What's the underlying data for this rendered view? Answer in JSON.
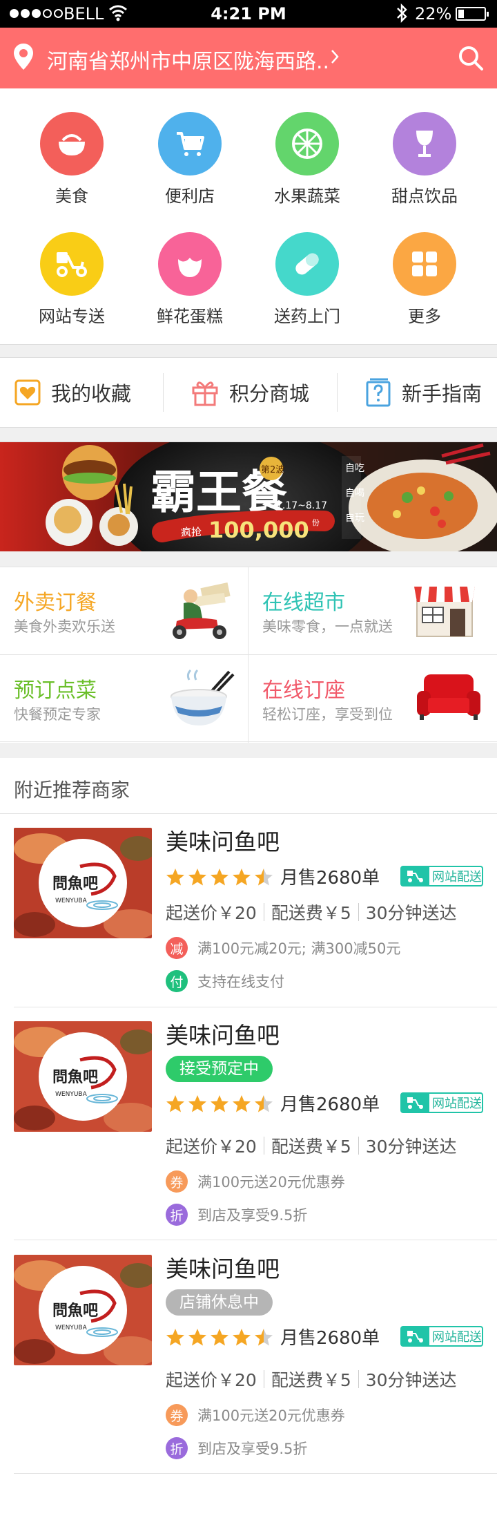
{
  "status_bar": {
    "carrier": "BELL",
    "time": "4:21 PM",
    "battery": "22%",
    "battery_level": 0.22,
    "signal_bars_filled": 3,
    "signal_bars_total": 5
  },
  "header": {
    "address": "河南省郑州市中原区陇海西路..",
    "icons": [
      "location-pin-icon",
      "chevron-right-icon",
      "search-icon"
    ],
    "bg_color": "#ff6e6e"
  },
  "categories": [
    {
      "label": "美食",
      "icon": "bowl-icon",
      "color": "#f35f5a"
    },
    {
      "label": "便利店",
      "icon": "cart-icon",
      "color": "#4fb1ec"
    },
    {
      "label": "水果蔬菜",
      "icon": "fruit-icon",
      "color": "#63d56c"
    },
    {
      "label": "甜点饮品",
      "icon": "wine-glass-icon",
      "color": "#b382dc"
    },
    {
      "label": "网站专送",
      "icon": "scooter-icon",
      "color": "#f9cd16"
    },
    {
      "label": "鲜花蛋糕",
      "icon": "flower-icon",
      "color": "#f86398"
    },
    {
      "label": "送药上门",
      "icon": "pill-icon",
      "color": "#45d8cb"
    },
    {
      "label": "更多",
      "icon": "grid-icon",
      "color": "#fba743"
    }
  ],
  "quick_links": [
    {
      "label": "我的收藏",
      "icon": "heart-box-icon",
      "color": "#f5a623"
    },
    {
      "label": "积分商城",
      "icon": "gift-icon",
      "color": "#f37a7a"
    },
    {
      "label": "新手指南",
      "icon": "help-book-icon",
      "color": "#4aa3df"
    }
  ],
  "banner": {
    "title": "霸王餐",
    "issue": "第2波",
    "dates": "7.17~8.17",
    "count_prefix": "疯抢",
    "count": "100,000",
    "count_unit": "份",
    "side_words": [
      "自吃",
      "自喝",
      "自玩"
    ]
  },
  "services": [
    {
      "title": "外卖订餐",
      "subtitle": "美食外卖欢乐送",
      "color": "#f5a623",
      "icon": "delivery-rider-icon"
    },
    {
      "title": "在线超市",
      "subtitle": "美味零食，一点就送",
      "color": "#2fc3b4",
      "icon": "shop-front-icon"
    },
    {
      "title": "预订点菜",
      "subtitle": "快餐预定专家",
      "color": "#6bbf2a",
      "icon": "rice-bowl-icon"
    },
    {
      "title": "在线订座",
      "subtitle": "轻松订座，享受到位",
      "color": "#f15a6a",
      "icon": "sofa-icon"
    }
  ],
  "nearby": {
    "title": "附近推荐商家",
    "shops": [
      {
        "name": "美味问鱼吧",
        "logo_text": "問魚吧",
        "logo_sub": "WENYUBA",
        "tag": null,
        "rating": 4.5,
        "sold": "月售2680单",
        "delivery_label": "网站配送",
        "min_price": "起送价￥20",
        "delivery_fee": "配送费￥5",
        "eta": "30分钟送达",
        "promos": [
          {
            "badge": "减",
            "color": "#f35f5a",
            "text": "满100元减20元; 满300减50元"
          },
          {
            "badge": "付",
            "color": "#1fc07d",
            "text": "支持在线支付"
          }
        ]
      },
      {
        "name": "美味问鱼吧",
        "logo_text": "問魚吧",
        "logo_sub": "WENYUBA",
        "tag": {
          "text": "接受预定中",
          "color": "#2ecb6a"
        },
        "rating": 4.5,
        "sold": "月售2680单",
        "delivery_label": "网站配送",
        "min_price": "起送价￥20",
        "delivery_fee": "配送费￥5",
        "eta": "30分钟送达",
        "promos": [
          {
            "badge": "券",
            "color": "#f79a5a",
            "text": "满100元送20元优惠券"
          },
          {
            "badge": "折",
            "color": "#9a6bdc",
            "text": "到店及享受9.5折"
          }
        ]
      },
      {
        "name": "美味问鱼吧",
        "logo_text": "問魚吧",
        "logo_sub": "WENYUBA",
        "tag": {
          "text": "店铺休息中",
          "color": "#b5b5b5"
        },
        "rating": 4.5,
        "sold": "月售2680单",
        "delivery_label": "网站配送",
        "min_price": "起送价￥20",
        "delivery_fee": "配送费￥5",
        "eta": "30分钟送达",
        "promos": [
          {
            "badge": "券",
            "color": "#f79a5a",
            "text": "满100元送20元优惠券"
          },
          {
            "badge": "折",
            "color": "#9a6bdc",
            "text": "到店及享受9.5折"
          }
        ]
      }
    ]
  }
}
